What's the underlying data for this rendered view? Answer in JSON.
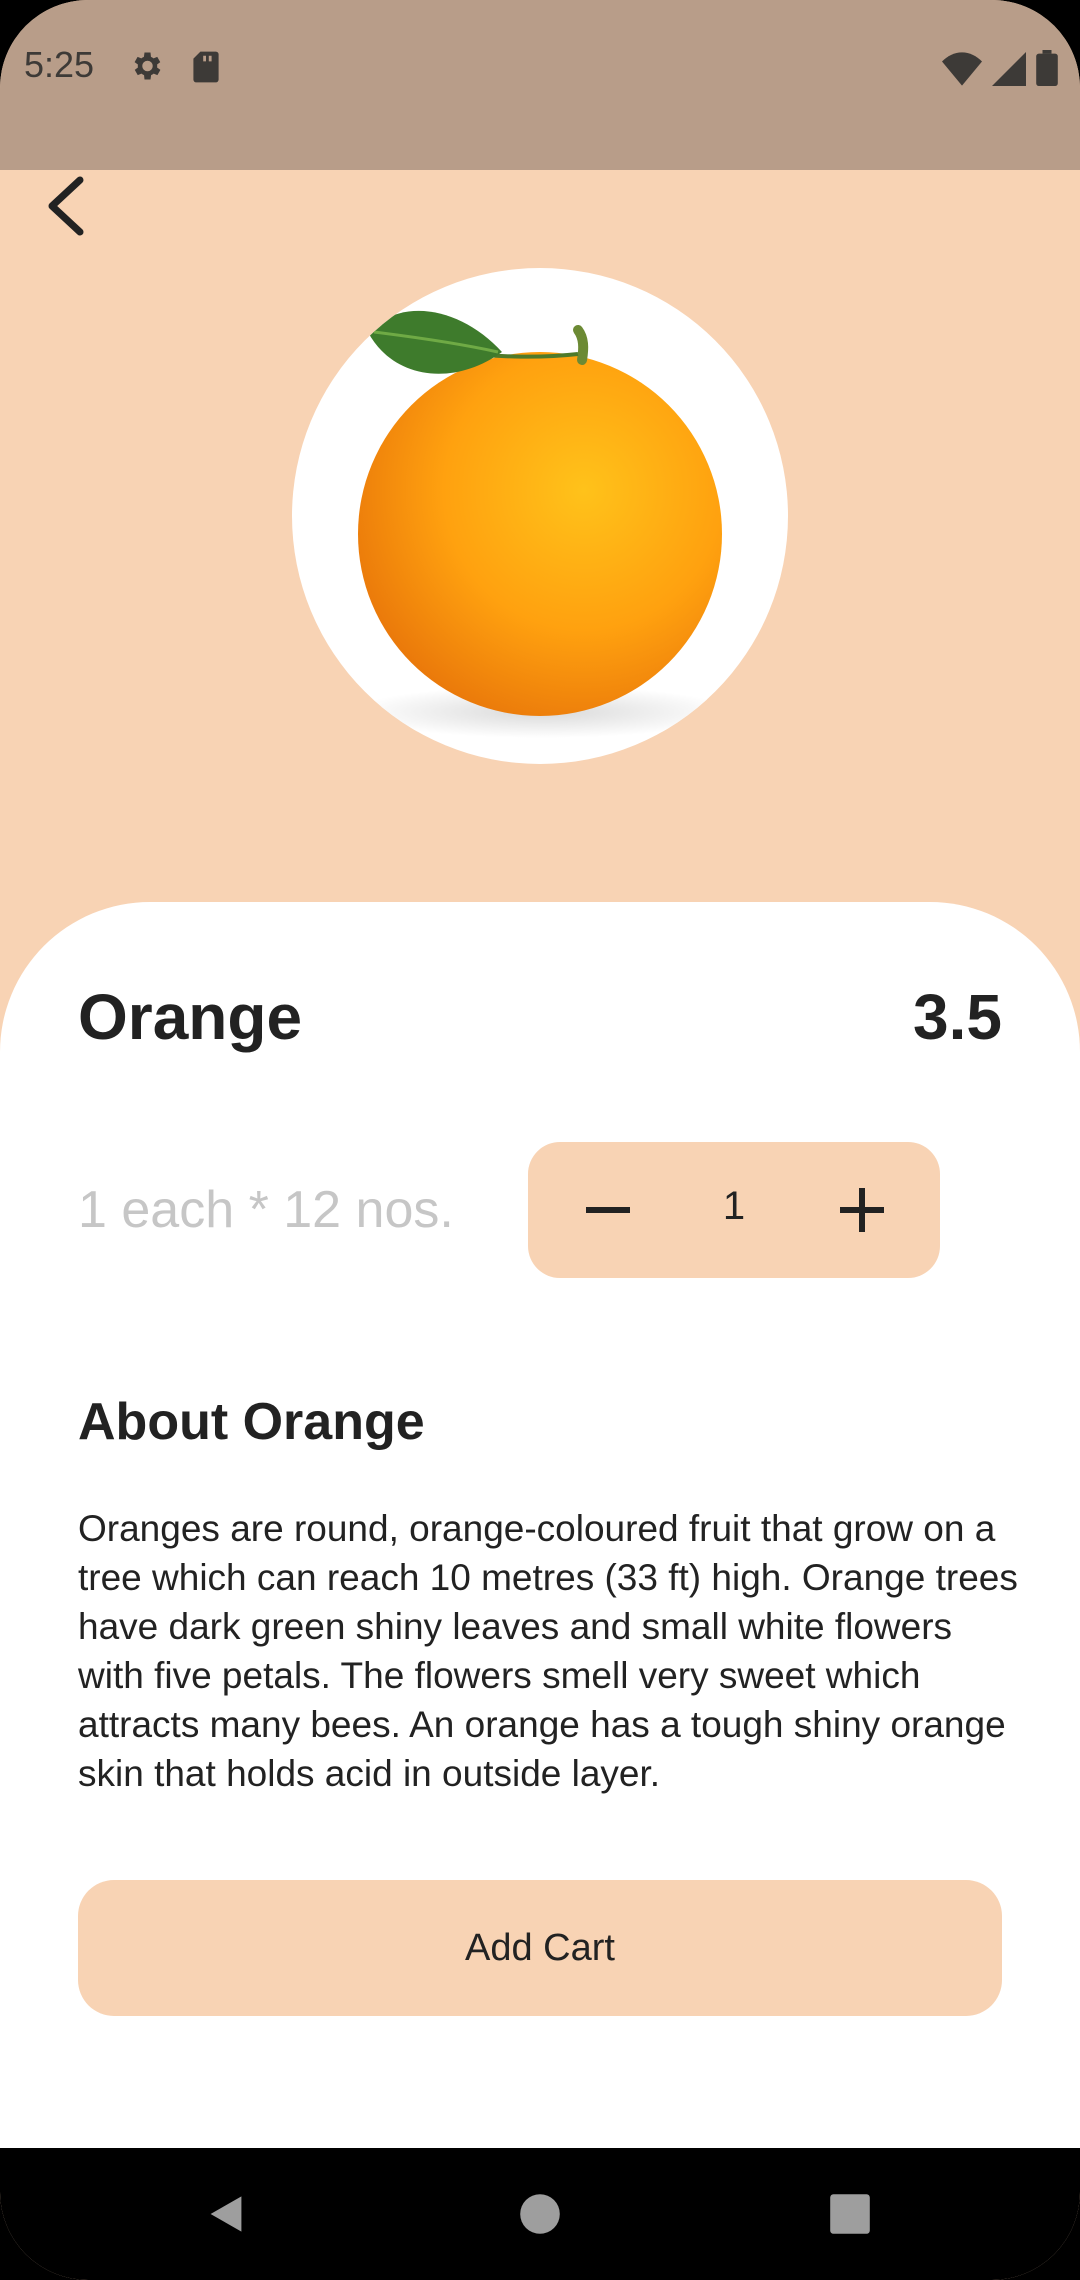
{
  "status_bar": {
    "time": "5:25",
    "icons": [
      "gear-icon",
      "sd-card-icon",
      "wifi-icon",
      "signal-icon",
      "battery-icon"
    ]
  },
  "header": {
    "back_icon": "chevron-left-icon"
  },
  "product": {
    "name": "Orange",
    "price": "3.5",
    "unit": "1 each * 12 nos.",
    "quantity": "1",
    "about_heading": "About Orange",
    "description": "Oranges are round, orange-coloured fruit that grow on a tree which can reach 10 metres (33 ft) high. Orange trees have dark green shiny leaves and small white flowers with five petals. The flowers smell very sweet which attracts many bees. An orange has a tough shiny orange skin that holds acid in outside layer."
  },
  "actions": {
    "add_cart_label": "Add Cart"
  },
  "colors": {
    "accent": "#f8d3b4",
    "status_bar": "#b89d89",
    "text": "#222222",
    "muted_text": "#c6c6c6"
  }
}
